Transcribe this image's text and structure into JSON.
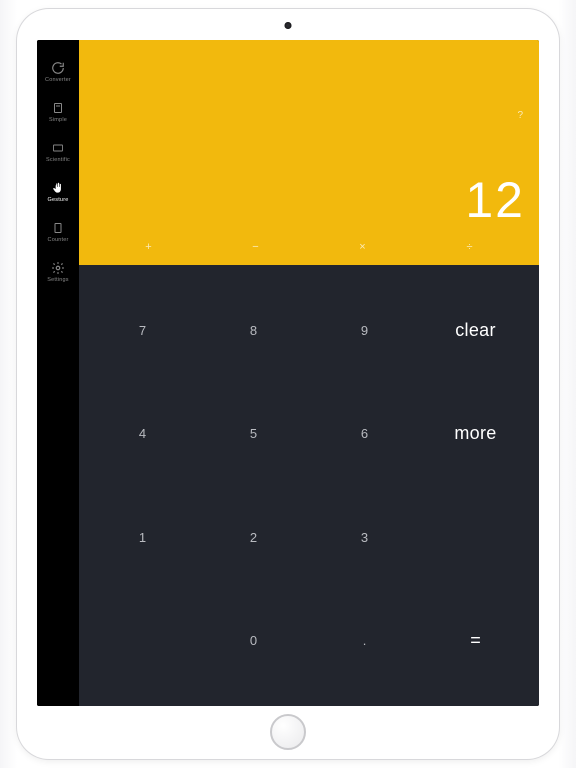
{
  "sidebar": {
    "items": [
      {
        "label": "Converter"
      },
      {
        "label": "Simple"
      },
      {
        "label": "Scientific"
      },
      {
        "label": "Gesture"
      },
      {
        "label": "Counter"
      },
      {
        "label": "Settings"
      }
    ]
  },
  "display": {
    "value": "12",
    "help": "?",
    "operators": [
      "+",
      "−",
      "×",
      "÷"
    ]
  },
  "keypad": {
    "r1": [
      "7",
      "8",
      "9"
    ],
    "r2": [
      "4",
      "5",
      "6"
    ],
    "r3": [
      "1",
      "2",
      "3"
    ],
    "r4_zero": "0",
    "r4_dot": ".",
    "clear": "clear",
    "more": "more",
    "equals": "="
  },
  "colors": {
    "accent": "#f2b90d",
    "keypad": "#22252d"
  }
}
